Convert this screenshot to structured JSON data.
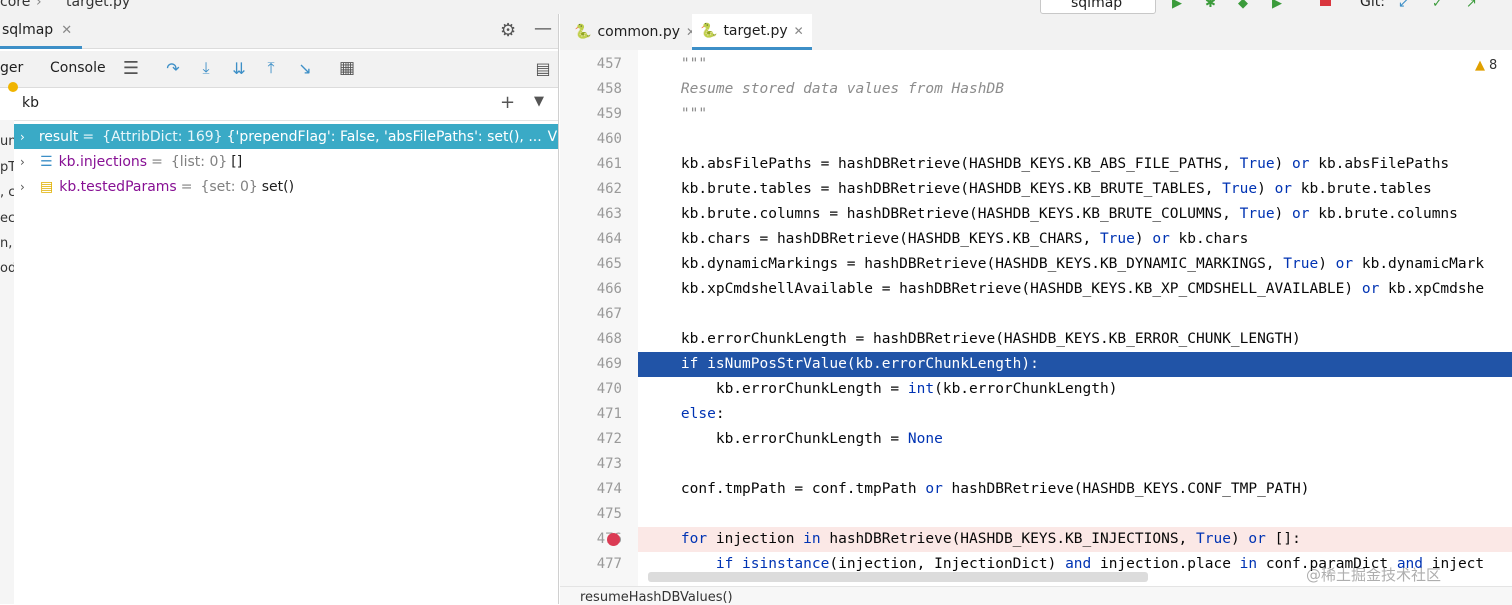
{
  "topbar": {
    "crumb_project": "core",
    "crumb_file": "target.py",
    "run_config": "sqlmap",
    "git_label": "Git:"
  },
  "left_panel": {
    "tab_label": "sqlmap",
    "toolbar": {
      "debugger_tab": "ger",
      "console_tab": "Console"
    },
    "watch_input": "kb",
    "gutter_fragments": [
      "un",
      "pT",
      ", c",
      "ecc",
      "n, :",
      "od"
    ],
    "variables": [
      {
        "name": "result",
        "type": "{AttribDict: 169}",
        "value": "{'prependFlag': False, 'absFilePaths': set(), ...",
        "view": "View",
        "icon": "object-icon",
        "selected": true
      },
      {
        "name": "kb.injections",
        "type": "{list: 0}",
        "value": "[]",
        "icon": "list-icon",
        "selected": false
      },
      {
        "name": "kb.testedParams",
        "type": "{set: 0}",
        "value": "set()",
        "icon": "set-icon",
        "selected": false
      }
    ]
  },
  "editor": {
    "tabs": [
      {
        "label": "common.py",
        "active": false
      },
      {
        "label": "target.py",
        "active": true
      }
    ],
    "warnings_count": "8",
    "breadcrumb_status": "resumeHashDBValues()",
    "watermark": "@稀土掘金技术社区",
    "lines": [
      {
        "n": "457",
        "text": "    \"\"\"",
        "kind": "doc"
      },
      {
        "n": "458",
        "text": "    Resume stored data values from HashDB",
        "kind": "doc"
      },
      {
        "n": "459",
        "text": "    \"\"\"",
        "kind": "doc"
      },
      {
        "n": "460",
        "text": "",
        "kind": "plain"
      },
      {
        "n": "461",
        "text": "    kb.absFilePaths = hashDBRetrieve(HASHDB_KEYS.KB_ABS_FILE_PATHS, True) or kb.absFilePaths",
        "kind": "plain"
      },
      {
        "n": "462",
        "text": "    kb.brute.tables = hashDBRetrieve(HASHDB_KEYS.KB_BRUTE_TABLES, True) or kb.brute.tables",
        "kind": "plain"
      },
      {
        "n": "463",
        "text": "    kb.brute.columns = hashDBRetrieve(HASHDB_KEYS.KB_BRUTE_COLUMNS, True) or kb.brute.columns",
        "kind": "plain"
      },
      {
        "n": "464",
        "text": "    kb.chars = hashDBRetrieve(HASHDB_KEYS.KB_CHARS, True) or kb.chars",
        "kind": "plain"
      },
      {
        "n": "465",
        "text": "    kb.dynamicMarkings = hashDBRetrieve(HASHDB_KEYS.KB_DYNAMIC_MARKINGS, True) or kb.dynamicMark",
        "kind": "plain"
      },
      {
        "n": "466",
        "text": "    kb.xpCmdshellAvailable = hashDBRetrieve(HASHDB_KEYS.KB_XP_CMDSHELL_AVAILABLE) or kb.xpCmdshe",
        "kind": "plain"
      },
      {
        "n": "467",
        "text": "",
        "kind": "plain"
      },
      {
        "n": "468",
        "text": "    kb.errorChunkLength = hashDBRetrieve(HASHDB_KEYS.KB_ERROR_CHUNK_LENGTH)",
        "kind": "plain"
      },
      {
        "n": "469",
        "text": "    if isNumPosStrValue(kb.errorChunkLength):",
        "kind": "exec"
      },
      {
        "n": "470",
        "text": "        kb.errorChunkLength = int(kb.errorChunkLength)",
        "kind": "plain"
      },
      {
        "n": "471",
        "text": "    else:",
        "kind": "plain"
      },
      {
        "n": "472",
        "text": "        kb.errorChunkLength = None",
        "kind": "plain"
      },
      {
        "n": "473",
        "text": "",
        "kind": "plain"
      },
      {
        "n": "474",
        "text": "    conf.tmpPath = conf.tmpPath or hashDBRetrieve(HASHDB_KEYS.CONF_TMP_PATH)",
        "kind": "plain"
      },
      {
        "n": "475",
        "text": "",
        "kind": "plain"
      },
      {
        "n": "476",
        "text": "    for injection in hashDBRetrieve(HASHDB_KEYS.KB_INJECTIONS, True) or []:",
        "kind": "breakpoint"
      },
      {
        "n": "477",
        "text": "        if isinstance(injection, InjectionDict) and injection.place in conf.paramDict and inject",
        "kind": "plain"
      }
    ]
  },
  "colors": {
    "exec_line": "#2154a7",
    "breakpoint": "#db3b54",
    "selection": "#3aaac6",
    "keyword": "#0033b3"
  }
}
